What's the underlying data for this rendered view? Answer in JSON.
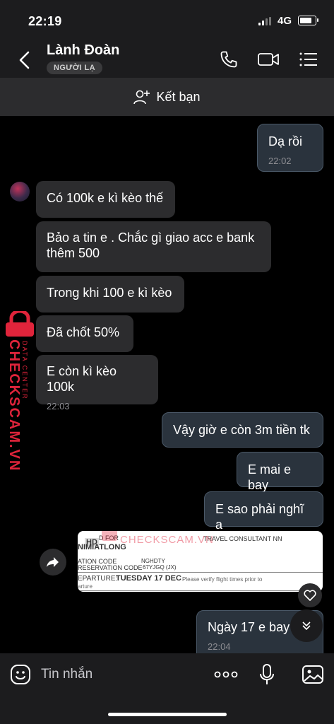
{
  "status_bar": {
    "time": "22:19",
    "network": "4G"
  },
  "header": {
    "contact_name": "Lành Đoàn",
    "badge": "NGƯỜI LẠ"
  },
  "add_friend": {
    "label": "Kết bạn"
  },
  "messages": {
    "m0": {
      "text": "Dạ rồi",
      "time": "22:02"
    },
    "m1": {
      "text": "Có 100k e kì kèo thế"
    },
    "m2": {
      "line1": "Bảo a tin e . Chắc gì giao acc e bank",
      "line2": "thêm 500"
    },
    "m3": {
      "text": "Trong khi 100 e kì kèo"
    },
    "m4": {
      "text": "Đã chốt 50%"
    },
    "m5": {
      "text": "E còn kì kèo 100k",
      "time": "22:03"
    },
    "m6": {
      "text": "Vậy giờ e còn 3m tiền tk"
    },
    "m7": {
      "text": "E mai e bay"
    },
    "m8": {
      "text": "E sao phải nghĩ a"
    },
    "m9": {
      "text": "Ngày 17 e bay",
      "time": "22:04"
    }
  },
  "ticket_image": {
    "hd": "HD",
    "line_a": "D FOR",
    "line_b": "NIMIATLONG",
    "travel": "TRAVEL CONSULTANT NN",
    "loc_label": "ATION CODE",
    "loc_value": "NGHDTY",
    "res_label": "RESERVATION CODE",
    "res_value": "67YJGQ (JX)",
    "dep_label": "EPARTURE:",
    "dep_value": "TUESDAY 17 DEC",
    "verify": "Please verify flight times prior to",
    "arture": "arture"
  },
  "watermark": {
    "brand": "CHECKSCAM.VN",
    "sub": "DATA CENTER"
  },
  "composer": {
    "placeholder": "Tin nhắn"
  },
  "colors": {
    "background": "#000000",
    "bubble_in": "#2c2c2e",
    "bubble_out": "#2a333d",
    "watermark": "#e0243b"
  }
}
